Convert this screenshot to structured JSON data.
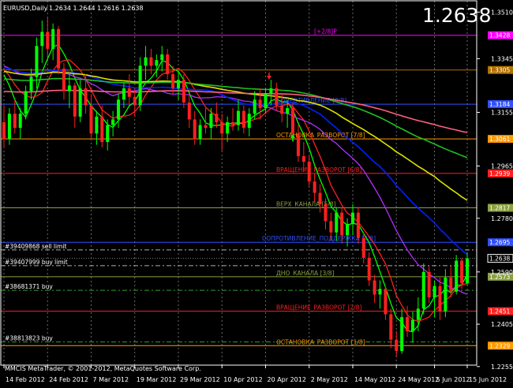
{
  "chart_data": {
    "type": "candlestick",
    "symbol_label": "EURUSD,Daily",
    "ohlc_label": "1.2634 1.2644 1.2616 1.2638",
    "big_price": "1.2638",
    "footer": "MMCIS MetaTrader, © 2001-2012, MetaQuotes Software Corp.",
    "ylim": [
      1.226,
      1.355
    ],
    "y_ticks": [
      "1.3510",
      "1.3345",
      "1.3155",
      "1.2965",
      "1.2780",
      "1.2590",
      "1.2405",
      "1.2255"
    ],
    "x_ticks": [
      "14 Feb 2012",
      "24 Feb 2012",
      "7 Mar 2012",
      "19 Mar 2012",
      "29 Mar 2012",
      "10 Apr 2012",
      "20 Apr 2012",
      "2 May 2012",
      "14 May 2012",
      "24 May 2012",
      "5 Jun 2012",
      "15 Jun 2012"
    ],
    "candles": [
      {
        "o": 1.312,
        "h": 1.318,
        "l": 1.303,
        "c": 1.306
      },
      {
        "o": 1.306,
        "h": 1.317,
        "l": 1.304,
        "c": 1.315
      },
      {
        "o": 1.315,
        "h": 1.32,
        "l": 1.308,
        "c": 1.31
      },
      {
        "o": 1.31,
        "h": 1.317,
        "l": 1.306,
        "c": 1.315
      },
      {
        "o": 1.315,
        "h": 1.325,
        "l": 1.313,
        "c": 1.323
      },
      {
        "o": 1.323,
        "h": 1.331,
        "l": 1.32,
        "c": 1.328
      },
      {
        "o": 1.328,
        "h": 1.342,
        "l": 1.324,
        "c": 1.339
      },
      {
        "o": 1.339,
        "h": 1.348,
        "l": 1.333,
        "c": 1.344
      },
      {
        "o": 1.344,
        "h": 1.349,
        "l": 1.335,
        "c": 1.338
      },
      {
        "o": 1.338,
        "h": 1.347,
        "l": 1.334,
        "c": 1.345
      },
      {
        "o": 1.345,
        "h": 1.346,
        "l": 1.329,
        "c": 1.331
      },
      {
        "o": 1.331,
        "h": 1.333,
        "l": 1.32,
        "c": 1.323
      },
      {
        "o": 1.323,
        "h": 1.329,
        "l": 1.317,
        "c": 1.325
      },
      {
        "o": 1.325,
        "h": 1.326,
        "l": 1.31,
        "c": 1.314
      },
      {
        "o": 1.314,
        "h": 1.327,
        "l": 1.312,
        "c": 1.324
      },
      {
        "o": 1.324,
        "h": 1.329,
        "l": 1.315,
        "c": 1.318
      },
      {
        "o": 1.318,
        "h": 1.322,
        "l": 1.306,
        "c": 1.308
      },
      {
        "o": 1.308,
        "h": 1.316,
        "l": 1.304,
        "c": 1.314
      },
      {
        "o": 1.314,
        "h": 1.318,
        "l": 1.303,
        "c": 1.305
      },
      {
        "o": 1.305,
        "h": 1.313,
        "l": 1.302,
        "c": 1.311
      },
      {
        "o": 1.311,
        "h": 1.316,
        "l": 1.307,
        "c": 1.313
      },
      {
        "o": 1.313,
        "h": 1.322,
        "l": 1.31,
        "c": 1.32
      },
      {
        "o": 1.32,
        "h": 1.326,
        "l": 1.317,
        "c": 1.324
      },
      {
        "o": 1.324,
        "h": 1.329,
        "l": 1.318,
        "c": 1.321
      },
      {
        "o": 1.321,
        "h": 1.324,
        "l": 1.314,
        "c": 1.318
      },
      {
        "o": 1.318,
        "h": 1.335,
        "l": 1.316,
        "c": 1.332
      },
      {
        "o": 1.332,
        "h": 1.339,
        "l": 1.327,
        "c": 1.335
      },
      {
        "o": 1.335,
        "h": 1.338,
        "l": 1.329,
        "c": 1.332
      },
      {
        "o": 1.332,
        "h": 1.336,
        "l": 1.328,
        "c": 1.334
      },
      {
        "o": 1.334,
        "h": 1.339,
        "l": 1.33,
        "c": 1.336
      },
      {
        "o": 1.336,
        "h": 1.338,
        "l": 1.327,
        "c": 1.329
      },
      {
        "o": 1.329,
        "h": 1.332,
        "l": 1.322,
        "c": 1.324
      },
      {
        "o": 1.324,
        "h": 1.33,
        "l": 1.32,
        "c": 1.327
      },
      {
        "o": 1.327,
        "h": 1.329,
        "l": 1.317,
        "c": 1.319
      },
      {
        "o": 1.319,
        "h": 1.322,
        "l": 1.31,
        "c": 1.313
      },
      {
        "o": 1.313,
        "h": 1.316,
        "l": 1.304,
        "c": 1.306
      },
      {
        "o": 1.306,
        "h": 1.313,
        "l": 1.304,
        "c": 1.311
      },
      {
        "o": 1.311,
        "h": 1.317,
        "l": 1.308,
        "c": 1.31
      },
      {
        "o": 1.31,
        "h": 1.317,
        "l": 1.306,
        "c": 1.315
      },
      {
        "o": 1.315,
        "h": 1.319,
        "l": 1.31,
        "c": 1.312
      },
      {
        "o": 1.312,
        "h": 1.315,
        "l": 1.302,
        "c": 1.308
      },
      {
        "o": 1.308,
        "h": 1.314,
        "l": 1.305,
        "c": 1.312
      },
      {
        "o": 1.312,
        "h": 1.317,
        "l": 1.309,
        "c": 1.311
      },
      {
        "o": 1.311,
        "h": 1.32,
        "l": 1.309,
        "c": 1.316
      },
      {
        "o": 1.316,
        "h": 1.318,
        "l": 1.308,
        "c": 1.31
      },
      {
        "o": 1.31,
        "h": 1.317,
        "l": 1.307,
        "c": 1.315
      },
      {
        "o": 1.315,
        "h": 1.323,
        "l": 1.313,
        "c": 1.32
      },
      {
        "o": 1.32,
        "h": 1.324,
        "l": 1.313,
        "c": 1.317
      },
      {
        "o": 1.317,
        "h": 1.324,
        "l": 1.315,
        "c": 1.322
      },
      {
        "o": 1.322,
        "h": 1.327,
        "l": 1.318,
        "c": 1.324
      },
      {
        "o": 1.324,
        "h": 1.326,
        "l": 1.316,
        "c": 1.318
      },
      {
        "o": 1.318,
        "h": 1.322,
        "l": 1.312,
        "c": 1.315
      },
      {
        "o": 1.315,
        "h": 1.32,
        "l": 1.31,
        "c": 1.317
      },
      {
        "o": 1.317,
        "h": 1.319,
        "l": 1.305,
        "c": 1.308
      },
      {
        "o": 1.308,
        "h": 1.311,
        "l": 1.298,
        "c": 1.3
      },
      {
        "o": 1.3,
        "h": 1.305,
        "l": 1.295,
        "c": 1.298
      },
      {
        "o": 1.298,
        "h": 1.3,
        "l": 1.289,
        "c": 1.291
      },
      {
        "o": 1.291,
        "h": 1.294,
        "l": 1.284,
        "c": 1.287
      },
      {
        "o": 1.287,
        "h": 1.29,
        "l": 1.28,
        "c": 1.283
      },
      {
        "o": 1.283,
        "h": 1.285,
        "l": 1.274,
        "c": 1.277
      },
      {
        "o": 1.277,
        "h": 1.28,
        "l": 1.27,
        "c": 1.273
      },
      {
        "o": 1.273,
        "h": 1.282,
        "l": 1.27,
        "c": 1.28
      },
      {
        "o": 1.28,
        "h": 1.282,
        "l": 1.269,
        "c": 1.272
      },
      {
        "o": 1.272,
        "h": 1.278,
        "l": 1.268,
        "c": 1.276
      },
      {
        "o": 1.276,
        "h": 1.283,
        "l": 1.272,
        "c": 1.28
      },
      {
        "o": 1.28,
        "h": 1.282,
        "l": 1.269,
        "c": 1.271
      },
      {
        "o": 1.271,
        "h": 1.273,
        "l": 1.262,
        "c": 1.264
      },
      {
        "o": 1.264,
        "h": 1.266,
        "l": 1.254,
        "c": 1.256
      },
      {
        "o": 1.256,
        "h": 1.258,
        "l": 1.248,
        "c": 1.251
      },
      {
        "o": 1.251,
        "h": 1.256,
        "l": 1.246,
        "c": 1.253
      },
      {
        "o": 1.253,
        "h": 1.254,
        "l": 1.242,
        "c": 1.244
      },
      {
        "o": 1.244,
        "h": 1.246,
        "l": 1.232,
        "c": 1.235
      },
      {
        "o": 1.235,
        "h": 1.238,
        "l": 1.229,
        "c": 1.231
      },
      {
        "o": 1.231,
        "h": 1.246,
        "l": 1.23,
        "c": 1.243
      },
      {
        "o": 1.243,
        "h": 1.247,
        "l": 1.236,
        "c": 1.238
      },
      {
        "o": 1.238,
        "h": 1.245,
        "l": 1.234,
        "c": 1.242
      },
      {
        "o": 1.242,
        "h": 1.25,
        "l": 1.238,
        "c": 1.246
      },
      {
        "o": 1.246,
        "h": 1.262,
        "l": 1.244,
        "c": 1.259
      },
      {
        "o": 1.259,
        "h": 1.261,
        "l": 1.248,
        "c": 1.25
      },
      {
        "o": 1.25,
        "h": 1.256,
        "l": 1.243,
        "c": 1.254
      },
      {
        "o": 1.254,
        "h": 1.257,
        "l": 1.242,
        "c": 1.245
      },
      {
        "o": 1.245,
        "h": 1.26,
        "l": 1.243,
        "c": 1.257
      },
      {
        "o": 1.257,
        "h": 1.261,
        "l": 1.25,
        "c": 1.252
      },
      {
        "o": 1.252,
        "h": 1.265,
        "l": 1.251,
        "c": 1.263
      },
      {
        "o": 1.263,
        "h": 1.264,
        "l": 1.253,
        "c": 1.255
      },
      {
        "o": 1.255,
        "h": 1.266,
        "l": 1.254,
        "c": 1.2638
      }
    ],
    "levels": [
      {
        "price": 1.3428,
        "color": "#ff00ff",
        "style": "solid",
        "label": "[+2/8]P",
        "price_label": "1.3428"
      },
      {
        "price": 1.3305,
        "color": "#b07000",
        "style": "solid",
        "label": "",
        "price_label": "1.3305"
      },
      {
        "price": 1.3184,
        "color": "#3050ff",
        "style": "solid",
        "label": "СОПРОТИВЛЕНИЕ [8/8]",
        "price_label": "1.3184"
      },
      {
        "price": 1.3061,
        "color": "#ff9900",
        "style": "solid",
        "label": "ОСТАНОВКА_РАЗВОРОТ [7/8]",
        "price_label": "1.3061"
      },
      {
        "price": 1.2939,
        "color": "#ff2020",
        "style": "solid",
        "label": "ВРАЩЕНИЕ_РАЗВОРОТ [6/8]",
        "price_label": "1.2939"
      },
      {
        "price": 1.2817,
        "color": "#8aa040",
        "style": "solid",
        "label": "ВЕРХ_КАНАЛА [5/8]",
        "price_label": "1.2817"
      },
      {
        "price": 1.2695,
        "color": "#3050ff",
        "style": "solid",
        "label": "СОПРОТИВЛЕНИЕ_ПОДДЕРЖКА [4/8]",
        "price_label": "1.2695"
      },
      {
        "price": 1.2573,
        "color": "#8aa040",
        "style": "solid",
        "label": "ДНО_КАНАЛА [3/8]",
        "price_label": "1.2573"
      },
      {
        "price": 1.2451,
        "color": "#ff2020",
        "style": "solid",
        "label": "ВРАЩЕНИЕ_РАЗВОРОТ [2/8]",
        "price_label": "1.2451"
      },
      {
        "price": 1.2329,
        "color": "#ff9900",
        "style": "solid",
        "label": "ОСТАНОВКА_РАЗВОРОТ [1/8]",
        "price_label": "1.2329"
      }
    ],
    "orders": [
      {
        "price": 1.2668,
        "label": "#39409868 sell limit",
        "color": "#b0b0b0"
      },
      {
        "price": 1.2612,
        "label": "#39407999 buy limit",
        "color": "#b0b0b0"
      },
      {
        "price": 1.2525,
        "label": "#38681371 buy",
        "color": "#30a030"
      },
      {
        "price": 1.2342,
        "label": "#38813823 buy",
        "color": "#30a030"
      }
    ],
    "current_price": {
      "price": 1.2638,
      "label": "1.2638"
    },
    "moving_averages": [
      {
        "name": "MA green",
        "color": "#00ff00",
        "period": 5
      },
      {
        "name": "MA red",
        "color": "#ff2020",
        "period": 8
      },
      {
        "name": "MA violet",
        "color": "#b030ff",
        "period": 21
      },
      {
        "name": "MA blue",
        "color": "#0020ff",
        "period": 34
      },
      {
        "name": "MA yellow",
        "color": "#e0e000",
        "period": 55
      },
      {
        "name": "MA lime",
        "color": "#20c020",
        "period": 89
      },
      {
        "name": "MA pink",
        "color": "#ff6080",
        "period": 144
      }
    ]
  }
}
